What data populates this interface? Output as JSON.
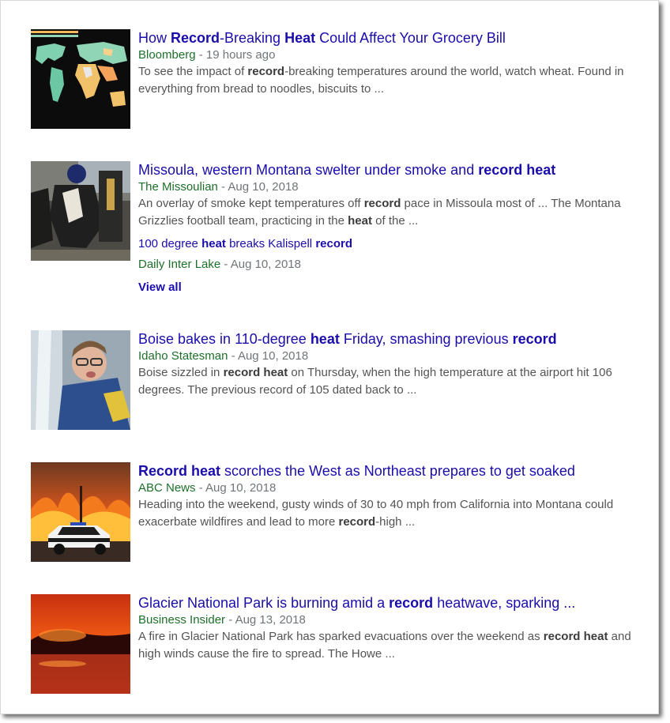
{
  "results": [
    {
      "title_parts": [
        "How ",
        "Record",
        "-Breaking ",
        "Heat",
        " Could Affect Your Grocery Bill"
      ],
      "source": "Bloomberg",
      "separator": " - ",
      "date": "19 hours ago",
      "snippet_parts": [
        "To see the impact of ",
        "record",
        "-breaking temperatures around the world, watch wheat. Found in everything from bread to noodles, biscuits to ..."
      ],
      "thumbnail": "world-heat-map-thumbnail"
    },
    {
      "title_parts": [
        "Missoula, western Montana swelter under smoke and ",
        "record heat"
      ],
      "source": "The Missoulian",
      "separator": " - ",
      "date": "Aug 10, 2018",
      "snippet_parts": [
        "An overlay of smoke kept temperatures off ",
        "record",
        " pace in Missoula most of ... The Montana Grizzlies football team, practicing in the ",
        "heat",
        " of the ..."
      ],
      "thumbnail": "football-players-thumbnail",
      "related": {
        "title_parts": [
          "100 degree ",
          "heat",
          " breaks Kalispell ",
          "record"
        ],
        "source": "Daily Inter Lake",
        "separator": " - ",
        "date": "Aug 10, 2018"
      },
      "view_all": "View all"
    },
    {
      "title_parts": [
        "Boise bakes in 110-degree ",
        "heat",
        " Friday, smashing previous ",
        "record"
      ],
      "source": "Idaho Statesman",
      "separator": " - ",
      "date": "Aug 10, 2018",
      "snippet_parts": [
        "Boise sizzled in ",
        "record heat",
        " on Thursday, when the high temperature at the airport hit 106 degrees. The previous record of 105 dated back to ..."
      ],
      "thumbnail": "boy-in-fountain-thumbnail"
    },
    {
      "title_parts": [
        "",
        "Record heat",
        " scorches the West as Northeast prepares to get soaked"
      ],
      "source": "ABC News",
      "separator": " - ",
      "date": "Aug 10, 2018",
      "snippet_parts": [
        "Heading into the weekend, gusty winds of 30 to 40 mph from California into Montana could exacerbate wildfires and lead to more ",
        "record",
        "-high ..."
      ],
      "thumbnail": "wildfire-police-car-thumbnail"
    },
    {
      "title_parts": [
        "Glacier National Park is burning amid a ",
        "record",
        " heatwave, sparking ..."
      ],
      "source": "Business Insider",
      "separator": " - ",
      "date": "Aug 13, 2018",
      "snippet_parts": [
        "A fire in Glacier National Park has sparked evacuations over the weekend as ",
        "record heat",
        " and high winds cause the fire to spread. The Howe ..."
      ],
      "thumbnail": "glacier-fire-thumbnail"
    }
  ]
}
